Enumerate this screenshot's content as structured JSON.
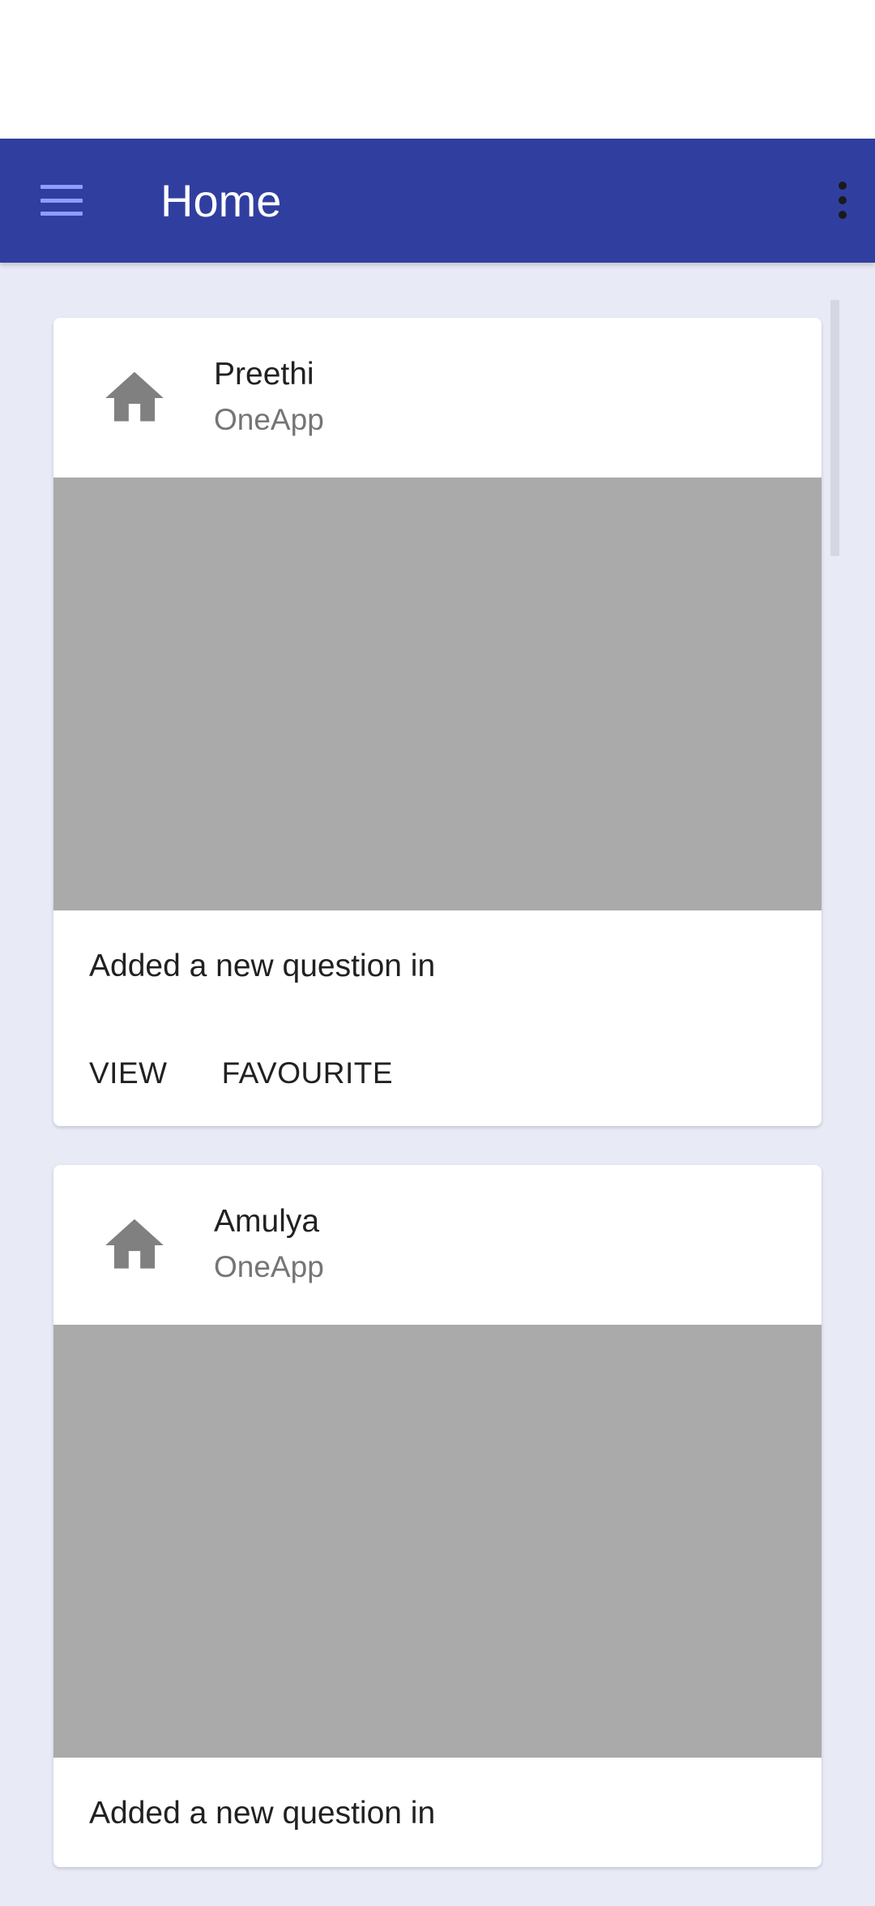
{
  "app_bar": {
    "title": "Home",
    "background_color": "#303F9F",
    "menu_icon": "hamburger-menu-icon",
    "overflow_icon": "more-vert-icon"
  },
  "feed": {
    "cards": [
      {
        "icon": "house-icon",
        "name": "Preethi",
        "subtitle": "OneApp",
        "text": "Added a new question in",
        "actions": [
          "VIEW",
          "FAVOURITE"
        ]
      },
      {
        "icon": "house-icon",
        "name": "Amulya",
        "subtitle": "OneApp",
        "text": "Added a new question in",
        "actions": []
      }
    ]
  }
}
